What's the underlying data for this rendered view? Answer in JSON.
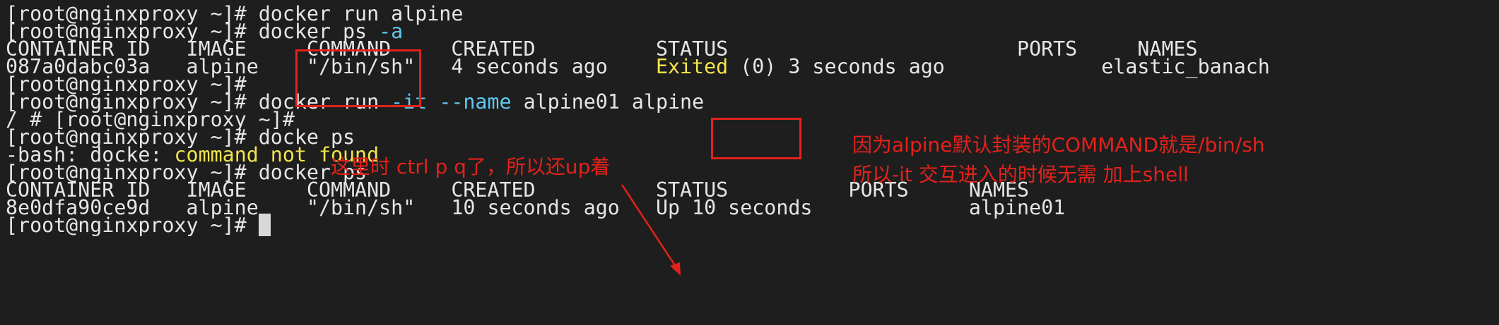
{
  "terminal": {
    "lines": [
      {
        "prompt": "[root@nginxproxy ~]# ",
        "cmd": "docker run alpine"
      },
      {
        "prompt": "[root@nginxproxy ~]# ",
        "cmd": "docker ps ",
        "flag": "-a"
      },
      {
        "text": "CONTAINER ID   IMAGE     COMMAND     CREATED          STATUS                        PORTS     NAMES"
      },
      {
        "pre": "087a0dabc03a   alpine    \"/bin/sh\"   4 seconds ago    ",
        "status_word": "Exited",
        "post": " (0) 3 seconds ago             elastic_banach"
      },
      {
        "prompt": "[root@nginxproxy ~]# ",
        "cmd": ""
      },
      {
        "prompt": "[root@nginxproxy ~]# ",
        "cmd": "docker run ",
        "flag1": "-it",
        "space": " ",
        "flag2": "--name",
        "rest": " alpine01 alpine"
      },
      {
        "text": "/ # [root@nginxproxy ~]#"
      },
      {
        "prompt": "[root@nginxproxy ~]# ",
        "cmd": "docke ps"
      },
      {
        "pre": "-bash: docke: ",
        "error": "command not found"
      },
      {
        "prompt": "[root@nginxproxy ~]# ",
        "cmd": "docker ps"
      },
      {
        "text": "CONTAINER ID   IMAGE     COMMAND     CREATED          STATUS          PORTS     NAMES"
      },
      {
        "text": "8e0dfa90ce9d   alpine    \"/bin/sh\"   10 seconds ago   Up 10 seconds             alpine01"
      },
      {
        "prompt": "[root@nginxproxy ~]# ",
        "cmd": ""
      }
    ]
  },
  "annotations": {
    "note_detach": "这里时 ctrl p q了，所以还up着",
    "note_command_line1": "因为alpine默认封装的COMMAND就是/bin/sh",
    "note_command_line2": "所以-it 交互进入的时候无需 加上shell"
  },
  "colors": {
    "background": "#1e1e1e",
    "text": "#e6e6e6",
    "flag": "#5ec8f0",
    "highlight": "#f3e64a",
    "annotation_red": "#e3221b"
  }
}
